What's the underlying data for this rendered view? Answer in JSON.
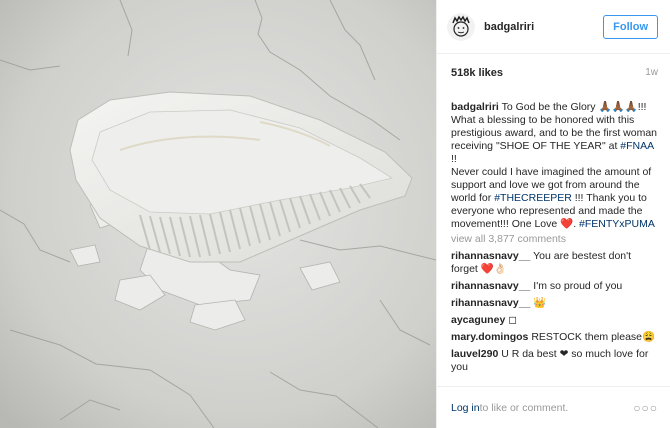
{
  "post": {
    "username": "badgalriri",
    "follow_label": "Follow",
    "likes": "518k likes",
    "age": "1w",
    "caption": {
      "username": "badgalriri",
      "parts": [
        {
          "text": " To God be the Glory ",
          "tag": false
        },
        {
          "text": "🙏🏾🙏🏾🙏🏾!!! What a blessing to be honored with this prestigious award, and to be the first woman receiving \"SHOE OF THE YEAR\" at ",
          "tag": false
        },
        {
          "text": "#FNAA",
          "tag": true
        },
        {
          "text": " !! ",
          "tag": false
        },
        {
          "text": "Never could I have imagined the amount of support and love we got from around the world for ",
          "tag": false
        },
        {
          "text": "#THECREEPER",
          "tag": true
        },
        {
          "text": " !!! Thank you to everyone who represented and made the movement!!! One Love ❤️. ",
          "tag": false
        },
        {
          "text": "#FENTYxPUMA",
          "tag": true
        }
      ]
    },
    "view_all": "view all 3,877 comments",
    "comments": [
      {
        "user": "rihannasnavy__",
        "text": " You are bestest don't forget ❤️👌🏻"
      },
      {
        "user": "rihannasnavy__",
        "text": " I'm so proud of you"
      },
      {
        "user": "rihannasnavy__",
        "text": " 👑"
      },
      {
        "user": "aycaguney",
        "text": " ◻"
      },
      {
        "user": "mary.domingos",
        "text": " RESTOCK them please😩"
      },
      {
        "user": "lauvel290",
        "text": " U R da best ❤ so much love for you"
      }
    ],
    "footer": {
      "login_label": "Log in",
      "rest_text": " to like or comment.",
      "more_label": "○○○"
    }
  }
}
